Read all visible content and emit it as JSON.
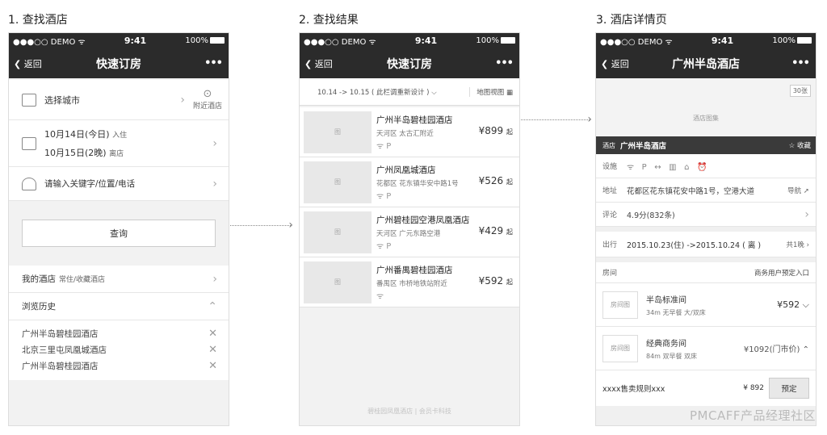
{
  "step1": {
    "title": "1. 查找酒店",
    "status": {
      "carrier": "●●●○○ DEMO ᯤ",
      "time": "9:41",
      "battery": "100%"
    },
    "nav": {
      "back": "❮ 返回",
      "title": "快速订房",
      "more": "•••"
    },
    "city_label": "选择城市",
    "nearby": "附近酒店",
    "checkin_date": "10月14日(今日)",
    "checkin_tag": "入住",
    "checkout_date": "10月15日(2晚)",
    "checkout_tag": "离店",
    "keyword_placeholder": "请输入关键字/位置/电话",
    "search_button": "查询",
    "my_hotels": "我的酒店",
    "my_hotels_sub": "常住/收藏酒店",
    "history_title": "浏览历史",
    "history": [
      "广州半岛碧桂园酒店",
      "北京三里屯凤凰城酒店",
      "广州半岛碧桂园酒店"
    ]
  },
  "step2": {
    "title": "2. 查找结果",
    "status": {
      "carrier": "●●●○○ DEMO ᯤ",
      "time": "9:41",
      "battery": "100%"
    },
    "nav": {
      "back": "❮ 返回",
      "title": "快速订房",
      "more": "•••"
    },
    "filter": "10.14 -> 10.15 ( 此栏调重新设计 ) ⌵",
    "map_view": "地图视图",
    "img_label": "图",
    "price_suffix": "起",
    "hotels": [
      {
        "name": "广州半岛碧桂园酒店",
        "addr": "天河区 太古汇附近",
        "fac": "ᯤ P",
        "price": "¥899"
      },
      {
        "name": "广州凤凰城酒店",
        "addr": "花都区 花东镇华安中路1号",
        "fac": "ᯤ P",
        "price": "¥526"
      },
      {
        "name": "广州碧桂园空港凤凰酒店",
        "addr": "天河区 广元东路空港",
        "fac": "ᯤ P",
        "price": "¥429"
      },
      {
        "name": "广州番禺碧桂园酒店",
        "addr": "番禺区 市桥地铁站附近",
        "fac": "ᯤ",
        "price": "¥592"
      }
    ],
    "footer": "碧桂园凤凰酒店 | 会员卡科技"
  },
  "step3": {
    "title": "3. 酒店详情页",
    "status": {
      "carrier": "●●●○○ DEMO ᯤ",
      "time": "9:41",
      "battery": "100%"
    },
    "nav": {
      "back": "❮ 返回",
      "title": "广州半岛酒店",
      "more": "•••"
    },
    "photo_count": "30张",
    "gallery": "酒店图集",
    "bar_tag": "酒店",
    "bar_name": "广州半岛酒店",
    "favorite": "☆ 收藏",
    "fac_label": "设施",
    "fac_icons": "ᯤ   P   ↔   ▥   ⌂   ⏰",
    "addr_label": "地址",
    "address": "花都区花东镇花安中路1号，空港大道",
    "nav_link": "导航 ➚",
    "review_label": "评论",
    "review": "4.9分(832条)",
    "travel_label": "出行",
    "travel": "2015.10.23(住) ->2015.10.24 ( 离 )",
    "nights": "共1晚",
    "room_label": "房间",
    "corp_entry": "商务用户预定入口",
    "room_img": "房间图",
    "rooms": [
      {
        "name": "半岛标准间",
        "desc": "34m 无早餐 大/双床",
        "price": "¥592 ⌵"
      },
      {
        "name": "经典商务间",
        "desc": "84m 双早餐 双床",
        "price": "¥1092(门市价) ⌃"
      }
    ],
    "rule": "xxxx售卖规则xxx",
    "rule_price": "¥ 892",
    "book": "预定"
  },
  "watermark": "PMCAFF产品经理社区"
}
